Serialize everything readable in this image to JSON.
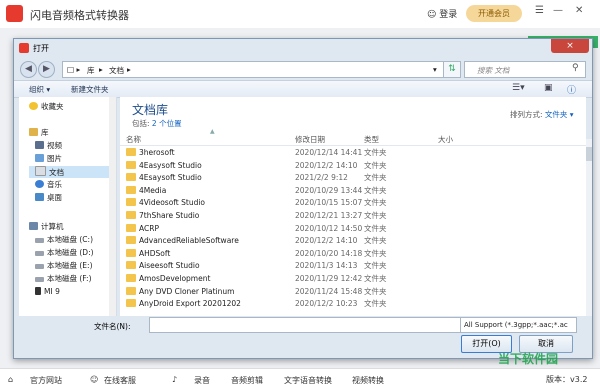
{
  "app": {
    "title": "闪电音频格式转换器",
    "login": "登录",
    "vip": "开通会员",
    "version": "版本：v3.2"
  },
  "bottom_bar": {
    "items": [
      "官方网站",
      "在线客服",
      "录音",
      "音频剪辑",
      "文字语音转换",
      "视频转换"
    ]
  },
  "dialog": {
    "title": "打开",
    "close": "×",
    "address": [
      "库",
      "文档"
    ],
    "search_placeholder": "搜索 文档",
    "toolbar": {
      "organize": "组织 ▾",
      "new_folder": "新建文件夹"
    },
    "nav": [
      {
        "label": "收藏夹",
        "icon": "star-icon"
      },
      {
        "label": "库",
        "icon": "library-icon"
      },
      {
        "label": "视频",
        "icon": "video-icon"
      },
      {
        "label": "图片",
        "icon": "picture-icon"
      },
      {
        "label": "文档",
        "icon": "document-icon",
        "selected": true
      },
      {
        "label": "音乐",
        "icon": "music-icon"
      },
      {
        "label": "桌面",
        "icon": "desktop-icon"
      },
      {
        "label": "计算机",
        "icon": "computer-icon"
      },
      {
        "label": "本地磁盘 (C:)",
        "icon": "disk-icon"
      },
      {
        "label": "本地磁盘 (D:)",
        "icon": "disk-icon"
      },
      {
        "label": "本地磁盘 (E:)",
        "icon": "disk-icon"
      },
      {
        "label": "本地磁盘 (F:)",
        "icon": "disk-icon"
      },
      {
        "label": "MI 9",
        "icon": "phone-icon"
      }
    ],
    "library": {
      "title": "文档库",
      "includes": "包括:",
      "locations": "2 个位置",
      "arrange_label": "排列方式:",
      "arrange_value": "文件夹 ▾"
    },
    "columns": {
      "name": "名称",
      "date": "修改日期",
      "type": "类型",
      "size": "大小"
    },
    "rows": [
      {
        "name": "3herosoft",
        "date": "2020/12/14 14:41",
        "type": "文件夹"
      },
      {
        "name": "4Easysoft Studio",
        "date": "2020/12/2 14:10",
        "type": "文件夹"
      },
      {
        "name": "4Esaysoft Studio",
        "date": "2021/2/2 9:12",
        "type": "文件夹"
      },
      {
        "name": "4Media",
        "date": "2020/10/29 13:44",
        "type": "文件夹"
      },
      {
        "name": "4Videosoft Studio",
        "date": "2020/10/15 15:07",
        "type": "文件夹"
      },
      {
        "name": "7thShare Studio",
        "date": "2020/12/21 13:27",
        "type": "文件夹"
      },
      {
        "name": "ACRP",
        "date": "2020/10/12 14:50",
        "type": "文件夹"
      },
      {
        "name": "AdvancedReliableSoftware",
        "date": "2020/12/2 14:10",
        "type": "文件夹"
      },
      {
        "name": "AHDSoft",
        "date": "2020/10/20 14:18",
        "type": "文件夹"
      },
      {
        "name": "Aiseesoft Studio",
        "date": "2020/11/3 14:13",
        "type": "文件夹"
      },
      {
        "name": "AmosDevelopment",
        "date": "2020/11/29 12:42",
        "type": "文件夹"
      },
      {
        "name": "Any DVD Cloner Platinum",
        "date": "2020/11/24 15:48",
        "type": "文件夹"
      },
      {
        "name": "AnyDroid Export 20201202",
        "date": "2020/12/2 10:23",
        "type": "文件夹"
      }
    ],
    "file_name_label": "文件名(N):",
    "file_name_value": "",
    "file_type": "All Support (*.3gpp;*.aac;*.ac",
    "open": "打开(O)",
    "cancel": "取消"
  },
  "watermark": "当下软件园"
}
